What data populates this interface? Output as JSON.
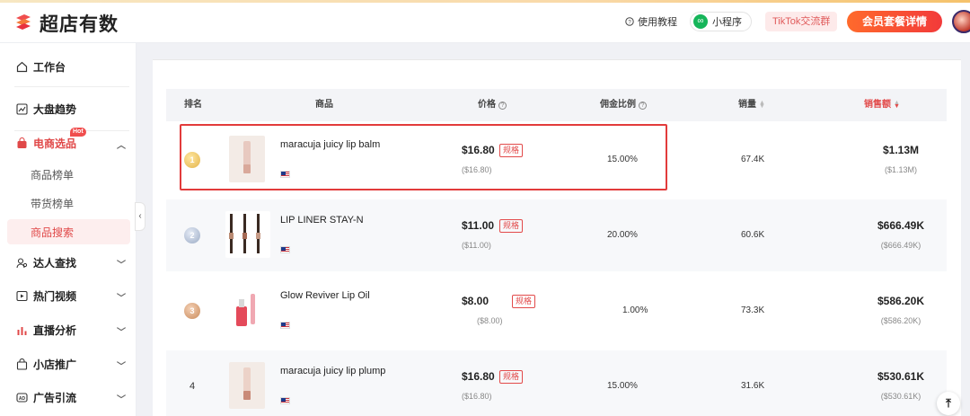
{
  "app": {
    "brand": "超店有数"
  },
  "header": {
    "help_label": "使用教程",
    "mini_program_label": "小程序",
    "tiktok_group_label": "TikTok交流群",
    "vip_label": "会员套餐详情"
  },
  "sidebar": {
    "items": [
      {
        "label": "工作台",
        "icon": "home-icon"
      },
      {
        "label": "大盘趋势",
        "icon": "trend-icon"
      },
      {
        "label": "电商选品",
        "icon": "shopping-bag-icon",
        "badge": "Hot"
      },
      {
        "label": "达人查找",
        "icon": "user-search-icon"
      },
      {
        "label": "热门视频",
        "icon": "video-icon"
      },
      {
        "label": "直播分析",
        "icon": "bar-chart-icon"
      },
      {
        "label": "小店推广",
        "icon": "store-icon"
      },
      {
        "label": "广告引流",
        "icon": "ad-icon"
      }
    ],
    "sub_items": [
      {
        "label": "商品榜单"
      },
      {
        "label": "带货榜单"
      },
      {
        "label": "商品搜索",
        "active": true
      }
    ]
  },
  "table": {
    "columns": [
      "排名",
      "商品",
      "价格",
      "佣金比例",
      "销量",
      "销售额"
    ],
    "spec_label": "规格",
    "rows": [
      {
        "rank": "1",
        "name": "maracuja juicy lip balm",
        "price": "$16.80",
        "price_sub": "($16.80)",
        "commission": "15.00%",
        "volume": "67.4K",
        "sales": "$1.13M",
        "sales_sub": "($1.13M)"
      },
      {
        "rank": "2",
        "name": "LIP LINER STAY-N",
        "price": "$11.00",
        "price_sub": "($11.00)",
        "commission": "20.00%",
        "volume": "60.6K",
        "sales": "$666.49K",
        "sales_sub": "($666.49K)"
      },
      {
        "rank": "3",
        "name": "Glow Reviver Lip Oil",
        "price": "$8.00",
        "price_sub": "($8.00)",
        "commission": "1.00%",
        "volume": "73.3K",
        "sales": "$586.20K",
        "sales_sub": "($586.20K)"
      },
      {
        "rank": "4",
        "name": "maracuja juicy lip plump",
        "price": "$16.80",
        "price_sub": "($16.80)",
        "commission": "15.00%",
        "volume": "31.6K",
        "sales": "$530.61K",
        "sales_sub": "($530.61K)"
      }
    ]
  },
  "colors": {
    "accent": "#e24a4a",
    "brand": "#f04e4e"
  }
}
